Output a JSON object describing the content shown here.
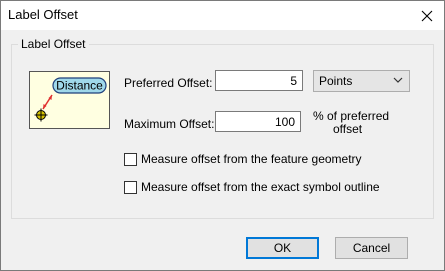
{
  "window": {
    "title": "Label Offset"
  },
  "group": {
    "title": "Label Offset"
  },
  "preview": {
    "label": "Distance"
  },
  "preferred": {
    "label": "Preferred Offset:",
    "value": "5",
    "unit": "Points"
  },
  "maximum": {
    "label": "Maximum Offset:",
    "value": "100",
    "suffix_line1": "% of preferred",
    "suffix_line2": "offset"
  },
  "options": {
    "feature_geometry": "Measure offset from the feature geometry",
    "symbol_outline": "Measure offset from the exact symbol outline"
  },
  "buttons": {
    "ok": "OK",
    "cancel": "Cancel"
  },
  "colors": {
    "preview_bg": "#ffffe1",
    "preview_label_bg": "#9fd8ea",
    "arrow": "#e03030",
    "point": "#d4c200"
  },
  "icons": {
    "close": "close-icon",
    "dropdown": "chevron-down-icon"
  }
}
